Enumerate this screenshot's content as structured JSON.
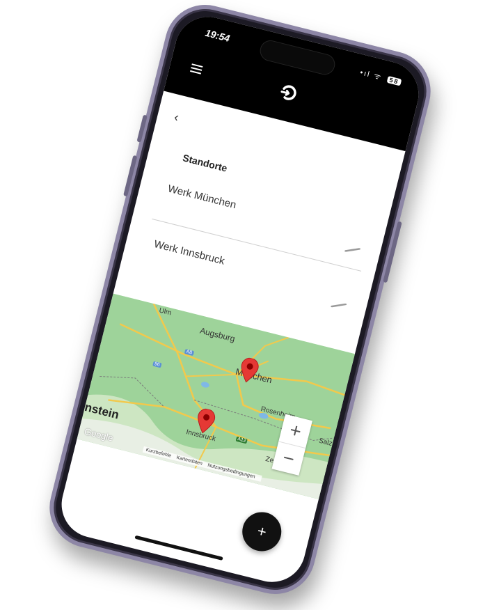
{
  "status_bar": {
    "time": "19:54",
    "battery": "58",
    "signal_wifi": "•ıl ᯤ"
  },
  "header": {
    "menu_icon": "hamburger-icon",
    "logo_icon": "brand-logo-icon"
  },
  "page": {
    "back_icon": "chevron-left-icon",
    "back_glyph": "‹",
    "title": "Standorte",
    "locations": [
      {
        "name": "Werk München",
        "edit_icon": "pencil-icon"
      },
      {
        "name": "Werk Innsbruck",
        "edit_icon": "pencil-icon"
      }
    ]
  },
  "map": {
    "labels": {
      "ulm": "Ulm",
      "augsburg": "Augsburg",
      "muenchen": "München",
      "rosenheim": "Rosenheim",
      "salzburg": "Salzb",
      "innsbruck": "Innsbruck",
      "zell": "Zell am",
      "liechtenstein": "nstein",
      "google": "Google",
      "a8": "A8",
      "a96": "96",
      "a12": "A12"
    },
    "zoom_in": "+",
    "zoom_out": "−",
    "footer": [
      "Kurzbefehle",
      "Kartendaten",
      "Nutzungsbedingungen"
    ],
    "pin_color": "#e53935",
    "map_color": "#9ed39a"
  },
  "fab": {
    "label": "+"
  }
}
